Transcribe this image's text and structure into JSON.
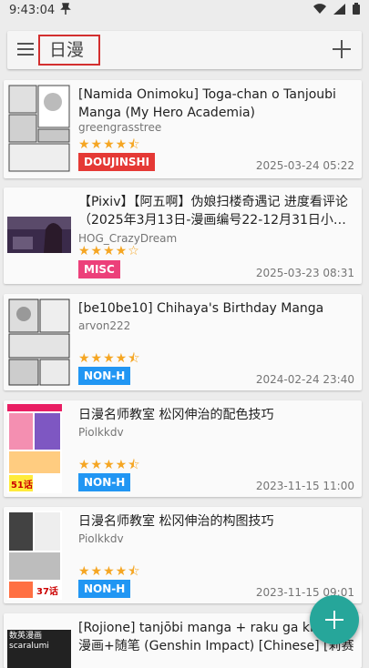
{
  "status_bar": {
    "time": "9:43:04",
    "notification_icon": "pin-icon",
    "icons": [
      "wifi-icon",
      "signal-icon",
      "battery-icon"
    ]
  },
  "app_bar": {
    "menu_icon": "menu-icon",
    "search_text": "日漫",
    "add_icon": "plus-icon",
    "highlight_color": "#d32f2f"
  },
  "gallery": [
    {
      "title": "[Namida Onimoku] Toga-chan o Tanjoubi Manga (My Hero Academia)",
      "uploader": "greengrasstree",
      "rating": 4.5,
      "category": "DOUJINSHI",
      "category_color": "#e53935",
      "date": "2025-03-24 05:22"
    },
    {
      "title": "【Pixiv】【阿五啊】伪娘扫楼奇遇记 进度看评论（2025年3月13日-漫画编号22-12月31日小…",
      "uploader": "HOG_CrazyDream",
      "rating": 4,
      "category": "MISC",
      "category_color": "#ec407a",
      "date": "2025-03-23 08:31"
    },
    {
      "title": "[be10be10] Chihaya's Birthday Manga",
      "uploader": "arvon222",
      "rating": 4.5,
      "category": "NON-H",
      "category_color": "#2196f3",
      "date": "2024-02-24 23:40"
    },
    {
      "title": "日漫名师教室 松冈伸治的配色技巧",
      "uploader": "Piolkkdv",
      "rating": 4.5,
      "category": "NON-H",
      "category_color": "#2196f3",
      "date": "2023-11-15 11:00"
    },
    {
      "title": "日漫名师教室 松冈伸治的构图技巧",
      "uploader": "Piolkkdv",
      "rating": 4.5,
      "category": "NON-H",
      "category_color": "#2196f3",
      "date": "2023-11-15 09:01"
    },
    {
      "title": "[Rojione] tanjōbi manga + raku ga ki | 生日漫画+随笔 (Genshin Impact) [Chinese] [莉赛特汉化组]",
      "uploader": "",
      "rating": null,
      "category": "",
      "category_color": "",
      "date": ""
    }
  ],
  "thumb_text": {
    "thumb4_caption": "51话",
    "thumb5_caption": "37话",
    "thumb6_caption": "数英漫画 scaralumi"
  },
  "fab": {
    "icon": "plus-icon",
    "color": "#26a69a"
  }
}
